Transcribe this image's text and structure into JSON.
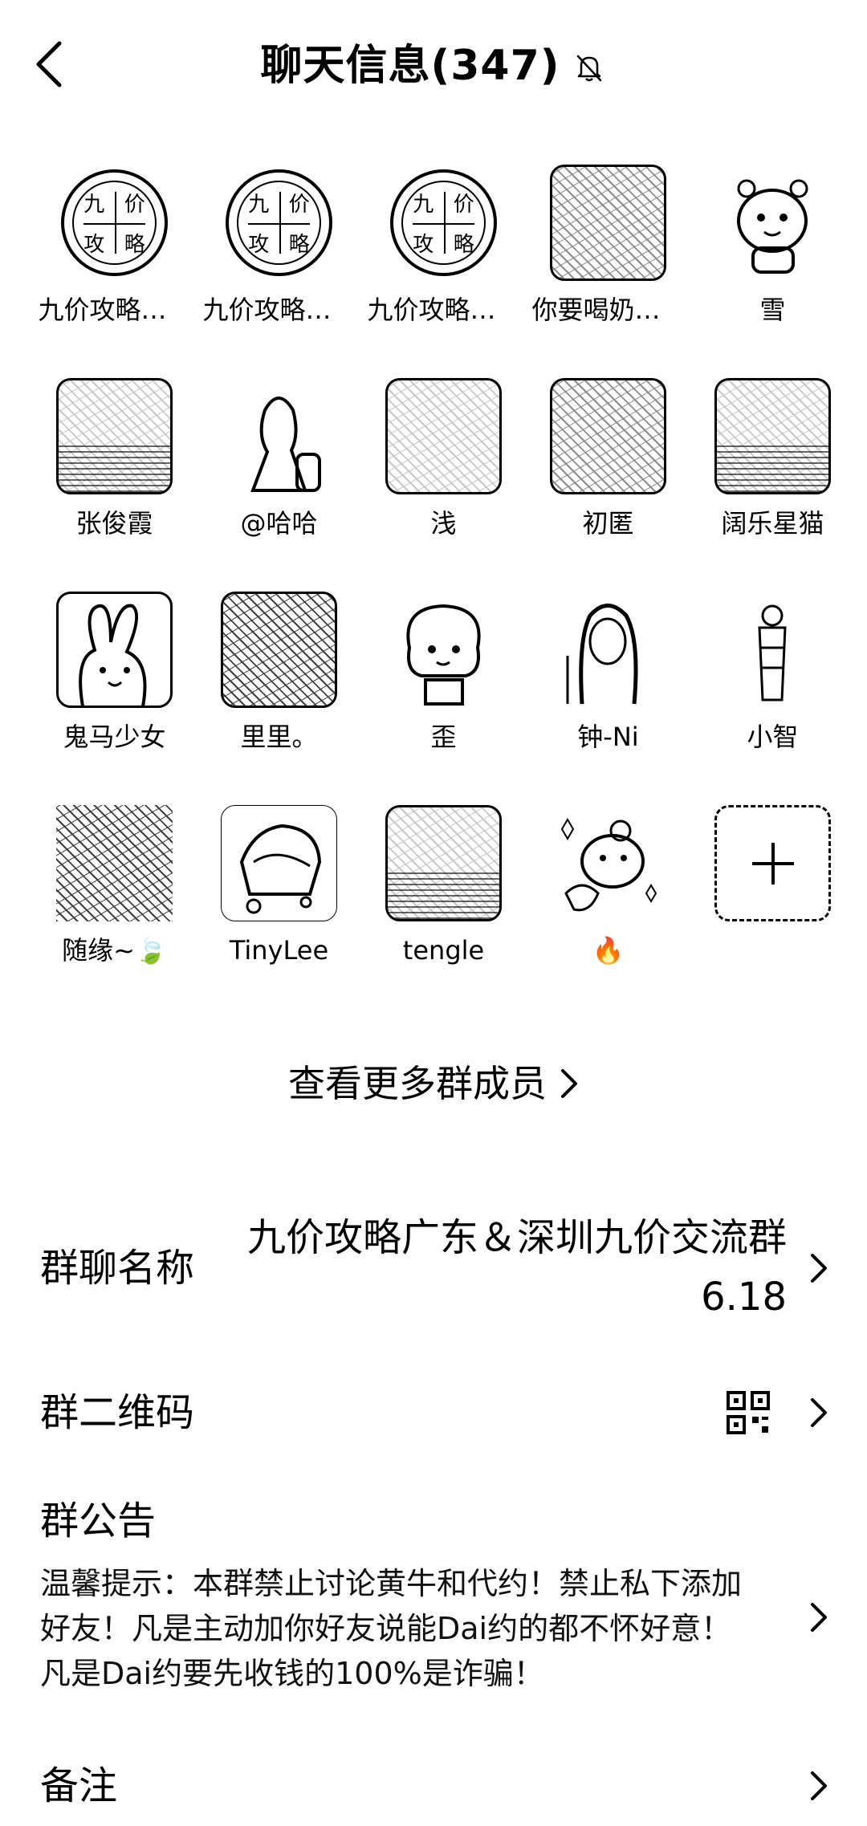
{
  "header": {
    "title": "聊天信息(347)",
    "back_icon": "chevron-left-icon",
    "mute_icon": "bell-off-icon"
  },
  "members": [
    {
      "name": "九价攻略广东",
      "avatar": "logo"
    },
    {
      "name": "九价攻略广东",
      "avatar": "logo"
    },
    {
      "name": "九价攻略广东",
      "avatar": "logo"
    },
    {
      "name": "你要喝奶茶吗",
      "avatar": "photo"
    },
    {
      "name": "雪",
      "avatar": "cartoon"
    },
    {
      "name": "张俊霞",
      "avatar": "photo"
    },
    {
      "name": "@哈哈",
      "avatar": "cartoon"
    },
    {
      "name": "浅",
      "avatar": "photo"
    },
    {
      "name": "初匿",
      "avatar": "photo"
    },
    {
      "name": "阔乐星猫",
      "avatar": "photo"
    },
    {
      "name": "鬼马少女",
      "avatar": "cartoon"
    },
    {
      "name": "里里。",
      "avatar": "photo"
    },
    {
      "name": "歪",
      "avatar": "cartoon"
    },
    {
      "name": "钟-Ni",
      "avatar": "cartoon"
    },
    {
      "name": "小智",
      "avatar": "cartoon"
    },
    {
      "name": "随缘~🍃",
      "avatar": "photo"
    },
    {
      "name": "TinyLee",
      "avatar": "cartoon"
    },
    {
      "name": "tengle",
      "avatar": "photo"
    },
    {
      "name": "🔥",
      "avatar": "cartoon"
    }
  ],
  "add_member_icon": "plus-icon",
  "more_members": {
    "label": "查看更多群成员",
    "icon": "chevron-right-icon"
  },
  "group_name": {
    "label": "群聊名称",
    "value": "九价攻略广东＆深圳九价交流群6.18"
  },
  "group_qr": {
    "label": "群二维码",
    "icon": "qr-code-icon"
  },
  "notice": {
    "label": "群公告",
    "text": "温馨提示：本群禁止讨论黄牛和代约！禁止私下添加好友！凡是主动加你好友说能Dai约的都不怀好意！凡是Dai约要先收钱的100%是诈骗！"
  },
  "remark": {
    "label": "备注"
  }
}
